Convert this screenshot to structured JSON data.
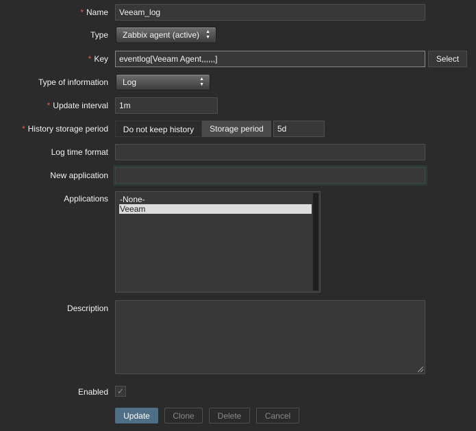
{
  "form": {
    "name": {
      "label": "Name",
      "required": "*",
      "value": "Veeam_log"
    },
    "type": {
      "label": "Type",
      "value": "Zabbix agent (active)"
    },
    "key": {
      "label": "Key",
      "required": "*",
      "value": "eventlog[Veeam Agent,,,,,,]",
      "select_label": "Select"
    },
    "type_of_information": {
      "label": "Type of information",
      "value": "Log"
    },
    "update_interval": {
      "label": "Update interval",
      "required": "*",
      "value": "1m"
    },
    "history_storage": {
      "label": "History storage period",
      "required": "*",
      "options": [
        "Do not keep history",
        "Storage period"
      ],
      "selected": "Storage period",
      "value": "5d"
    },
    "log_time_format": {
      "label": "Log time format",
      "value": ""
    },
    "new_application": {
      "label": "New application",
      "value": ""
    },
    "applications": {
      "label": "Applications",
      "options": [
        "-None-",
        "Veeam"
      ],
      "selected": "Veeam"
    },
    "description": {
      "label": "Description",
      "value": ""
    },
    "enabled": {
      "label": "Enabled",
      "checked": true,
      "check_glyph": "✓"
    }
  },
  "buttons": {
    "update": "Update",
    "clone": "Clone",
    "delete": "Delete",
    "cancel": "Cancel"
  },
  "icons": {
    "select_arrows": "updown-arrows-icon"
  },
  "colors": {
    "background": "#2b2b2b",
    "field": "#383838",
    "required": "#e45959",
    "primary_button": "#4f6f86",
    "focus_border": "#5a6c63"
  }
}
